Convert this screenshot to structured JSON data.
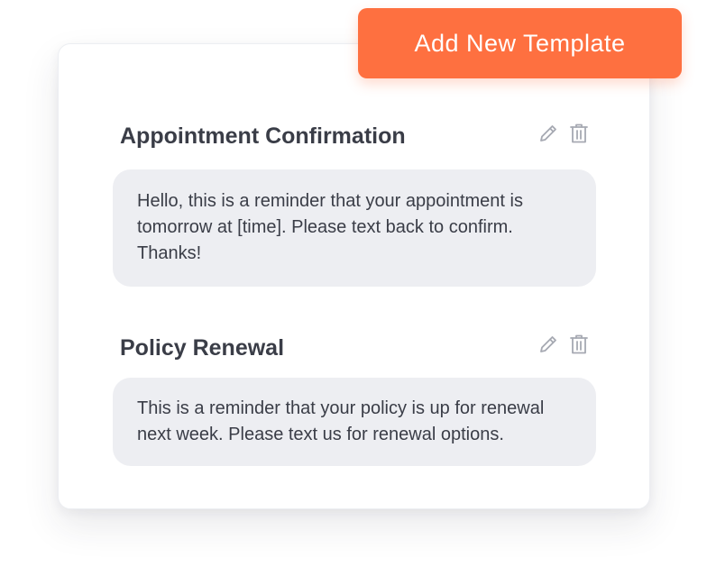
{
  "header": {
    "add_button_label": "Add New Template"
  },
  "templates": [
    {
      "title": "Appointment Confirmation",
      "message": "Hello, this is a reminder that your appointment is tomorrow at [time]. Please text back to confirm. Thanks!",
      "icons": [
        "pencil-icon",
        "trash-icon"
      ]
    },
    {
      "title": "Policy Renewal",
      "message": "This is a reminder that your policy is up for renewal next week. Please text us for renewal options.",
      "icons": [
        "pencil-icon",
        "trash-icon"
      ]
    }
  ],
  "colors": {
    "accent": "#fe7040",
    "bubble": "#edeef2",
    "text": "#3a3d47",
    "icon": "#a6a9b2"
  }
}
